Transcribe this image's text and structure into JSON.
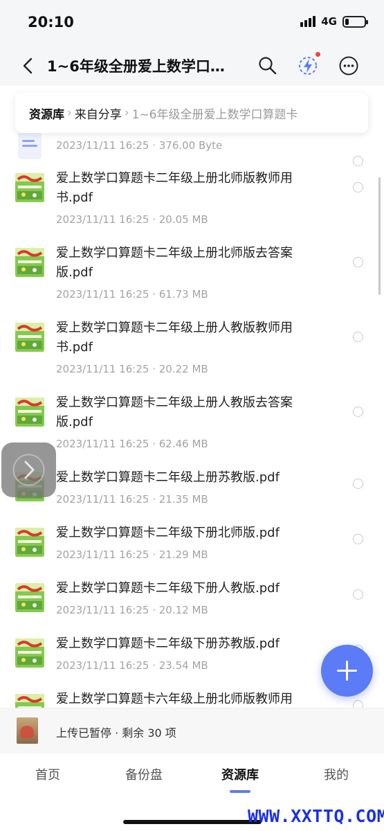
{
  "status": {
    "time": "20:10",
    "network": "4G",
    "battery_level": 0.2
  },
  "nav": {
    "title": "1~6年级全册爱上数学口…"
  },
  "breadcrumb": {
    "root": "资源库",
    "middle": "来自分享",
    "current": "1~6年级全册爱上数学口算题卡"
  },
  "files": [
    {
      "name": "",
      "meta": "2023/11/11 16:25 · 376.00 Byte",
      "thumb": "doc-icon"
    },
    {
      "name": "爱上数学口算题卡二年级上册北师版教师用书.pdf",
      "meta": "2023/11/11 16:25 · 20.05 MB",
      "thumb": "book-cover"
    },
    {
      "name": "爱上数学口算题卡二年级上册北师版去答案版.pdf",
      "meta": "2023/11/11 16:25 · 61.73 MB",
      "thumb": "book-cover"
    },
    {
      "name": "爱上数学口算题卡二年级上册人教版教师用书.pdf",
      "meta": "2023/11/11 16:25 · 20.22 MB",
      "thumb": "book-cover"
    },
    {
      "name": "爱上数学口算题卡二年级上册人教版去答案版.pdf",
      "meta": "2023/11/11 16:25 · 62.46 MB",
      "thumb": "book-cover"
    },
    {
      "name": "爱上数学口算题卡二年级上册苏教版.pdf",
      "meta": "2023/11/11 16:25 · 21.35 MB",
      "thumb": "book-cover"
    },
    {
      "name": "爱上数学口算题卡二年级下册北师版.pdf",
      "meta": "2023/11/11 16:25 · 21.29 MB",
      "thumb": "book-cover"
    },
    {
      "name": "爱上数学口算题卡二年级下册人教版.pdf",
      "meta": "2023/11/11 16:25 · 20.12 MB",
      "thumb": "book-cover"
    },
    {
      "name": "爱上数学口算题卡二年级下册苏教版.pdf",
      "meta": "2023/11/11 16:25 · 23.54 MB",
      "thumb": "book-cover"
    },
    {
      "name": "爱上数学口算题卡六年级上册北师版教师用",
      "meta": "",
      "thumb": "book-cover"
    }
  ],
  "upload": {
    "text": "上传已暂停 · 剩余 30 项"
  },
  "tabs": [
    {
      "label": "首页"
    },
    {
      "label": "备份盘"
    },
    {
      "label": "资源库",
      "active": true
    },
    {
      "label": "我的"
    }
  ],
  "watermark": "WWW.XXTTQ.COM",
  "colors": {
    "accent": "#5b7bf7",
    "badge": "#f2453d"
  }
}
